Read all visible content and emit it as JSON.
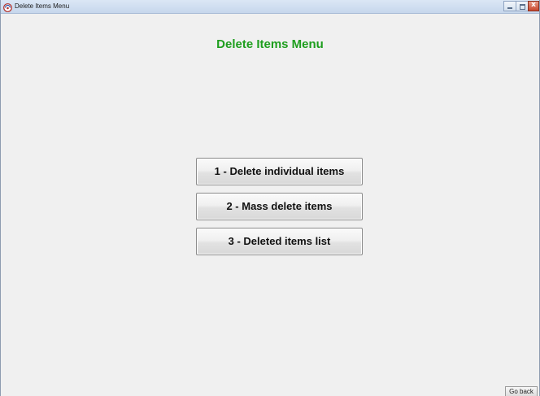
{
  "window": {
    "title": "Delete Items Menu",
    "icon": "app-icon"
  },
  "main": {
    "heading": "Delete Items Menu",
    "heading_color": "#1e9e1e",
    "buttons": [
      {
        "label": "1 - Delete individual items"
      },
      {
        "label": "2 - Mass delete items"
      },
      {
        "label": "3 - Deleted items list"
      }
    ]
  },
  "footer": {
    "go_back_label": "Go back"
  }
}
